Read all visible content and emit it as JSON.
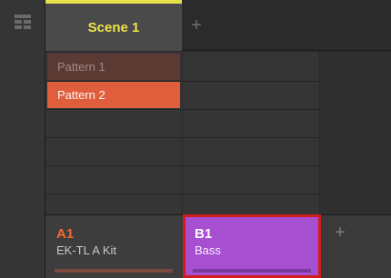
{
  "scene": {
    "tab_label": "Scene 1",
    "add_label": "+",
    "accent_color": "#e8e04b"
  },
  "patterns": [
    {
      "label": "Pattern 1",
      "color": "#5b3b34",
      "selected": false
    },
    {
      "label": "Pattern 2",
      "color": "#e05e3c",
      "selected": true
    }
  ],
  "groups": [
    {
      "id": "A1",
      "name": "EK-TL A Kit",
      "color": "#f06a3a",
      "selected": false
    },
    {
      "id": "B1",
      "name": "Bass",
      "color": "#a64fd1",
      "selected": true
    }
  ],
  "group_add_label": "+",
  "icons": {
    "arranger": "grid-view-icon"
  }
}
